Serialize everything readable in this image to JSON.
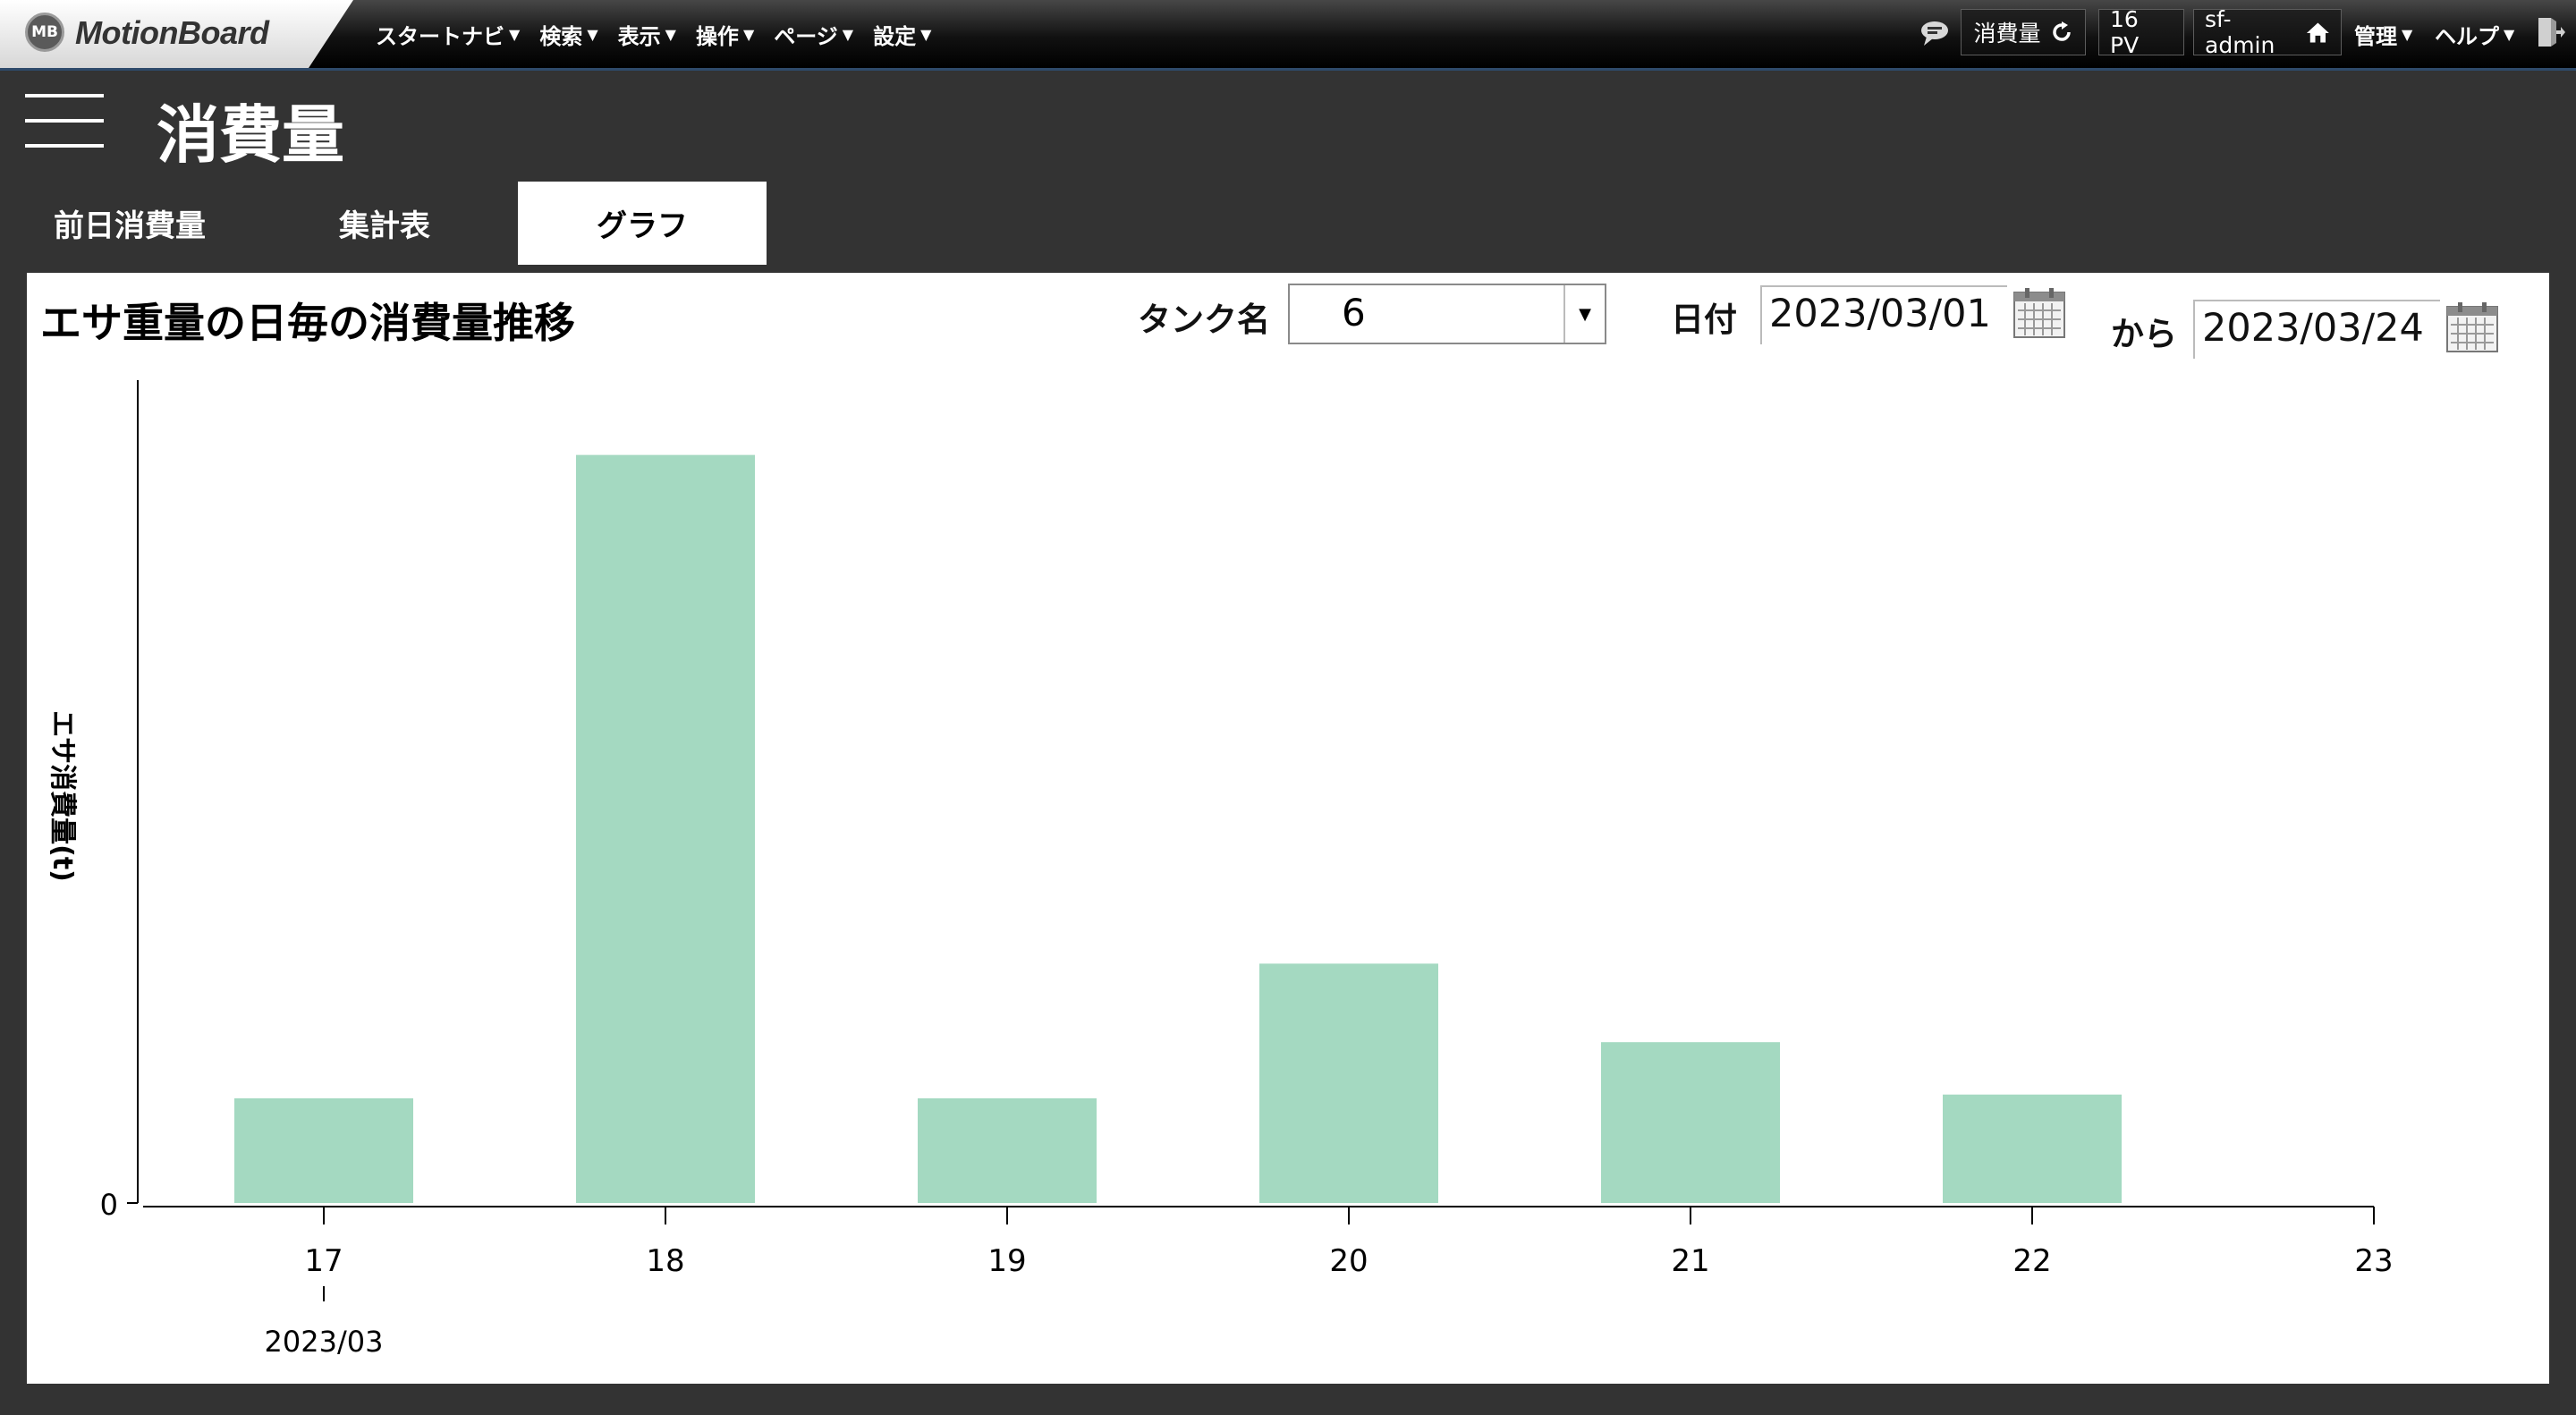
{
  "header": {
    "logo_badge": "MB",
    "logo_text": "MotionBoard",
    "nav": [
      {
        "label": "スタートナビ"
      },
      {
        "label": "検索"
      },
      {
        "label": "表示"
      },
      {
        "label": "操作"
      },
      {
        "label": "ページ"
      },
      {
        "label": "設定"
      }
    ],
    "board_name": "消費量",
    "pv": "16 PV",
    "user": "sf-admin",
    "admin_menu": "管理",
    "help_menu": "ヘルプ"
  },
  "page": {
    "title": "消費量",
    "tabs": [
      {
        "label": "前日消費量",
        "active": false
      },
      {
        "label": "集計表",
        "active": false
      },
      {
        "label": "グラフ",
        "active": true
      }
    ]
  },
  "panel": {
    "title": "エサ重量の日毎の消費量推移",
    "tank_label": "タンク名",
    "tank_value": "6",
    "date_label": "日付",
    "date_from": "2023/03/01",
    "date_sep": "から",
    "date_to": "2023/03/24"
  },
  "chart_data": {
    "type": "bar",
    "title": "",
    "ylabel": "エサ消費量(t)",
    "xlabel": "",
    "x_ticks": [
      "17",
      "18",
      "19",
      "20",
      "21",
      "22",
      "23"
    ],
    "x_sublabel": "2023/03",
    "y_tick_labels": [
      "0"
    ],
    "y_axis_visible_range": [
      0,
      1.1
    ],
    "categories": [
      "17",
      "18",
      "19",
      "20",
      "21",
      "22"
    ],
    "values": [
      0.14,
      1.0,
      0.14,
      0.32,
      0.215,
      0.145
    ],
    "bar_color": "#a4d9c1",
    "grid": false,
    "legend": "none"
  },
  "colors": {
    "background": "#333333",
    "panel": "#ffffff",
    "bar": "#a4d9c1"
  }
}
